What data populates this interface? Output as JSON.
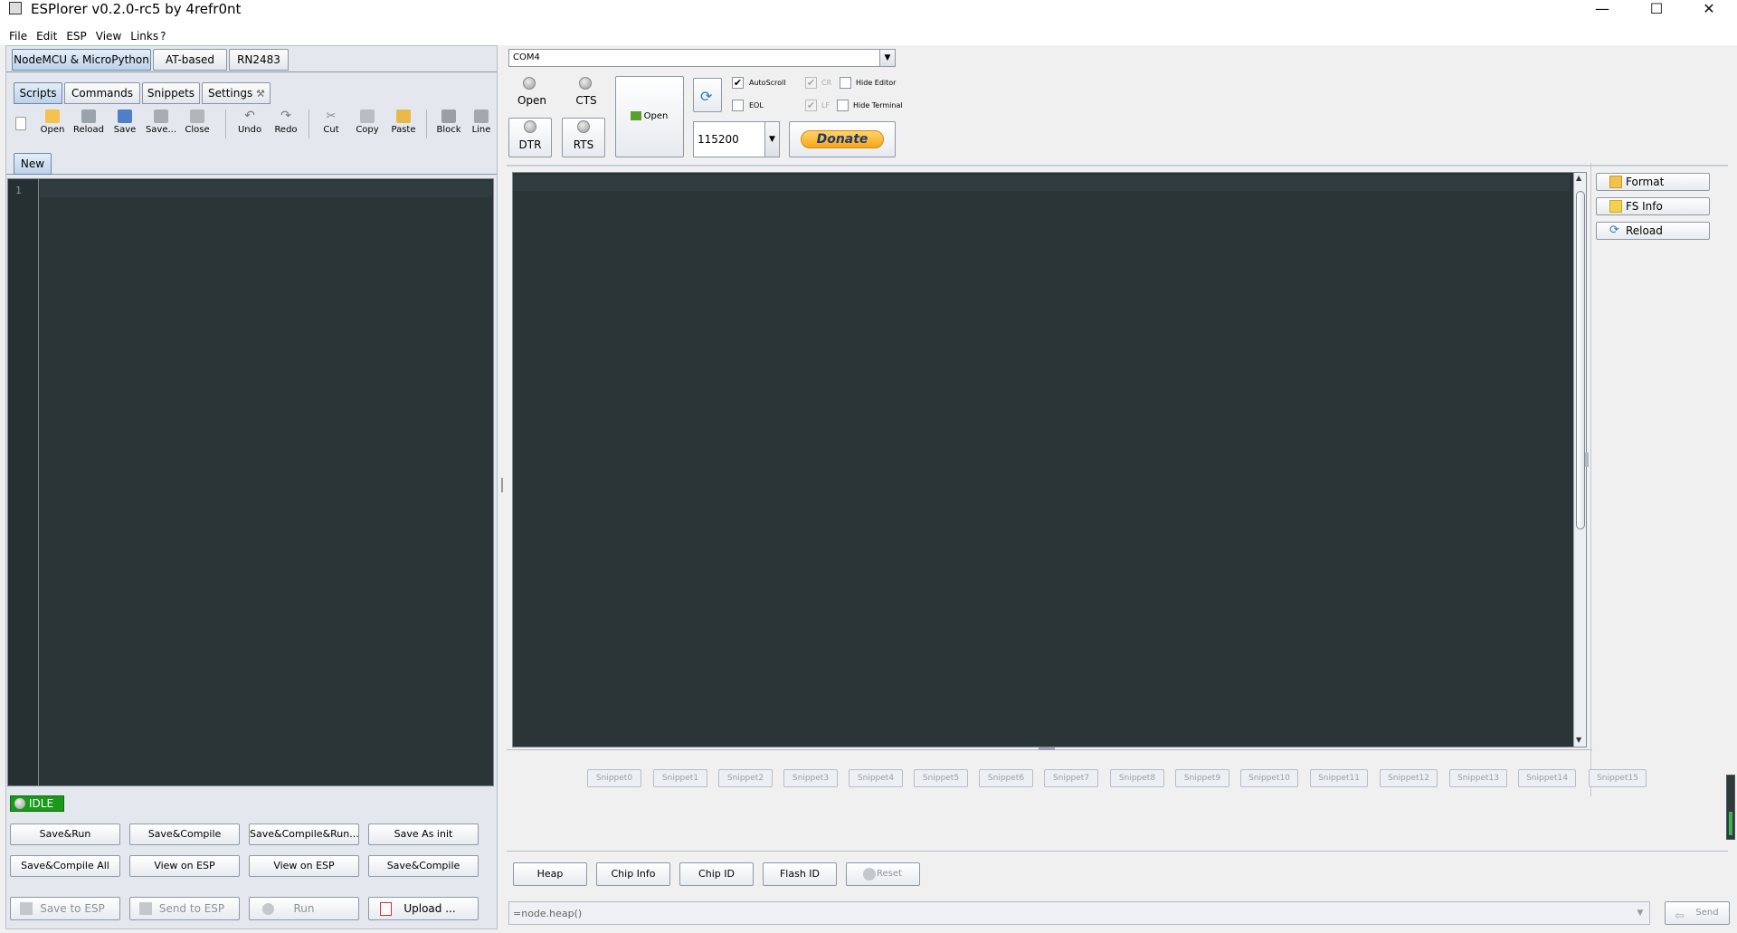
{
  "window": {
    "title": "ESPlorer v0.2.0-rc5 by 4refr0nt",
    "minimize_glyph": "—",
    "maximize_glyph": "☐",
    "close_glyph": "✕"
  },
  "menu": [
    "File",
    "Edit",
    "ESP",
    "View",
    "Links",
    "?"
  ],
  "device_tabs": [
    "NodeMCU & MicroPython",
    "AT-based",
    "RN2483"
  ],
  "sub_tabs": [
    "Scripts",
    "Commands",
    "Snippets",
    "Settings"
  ],
  "toolbar": [
    "Open",
    "Reload",
    "Save",
    "Save...",
    "Close",
    "Undo",
    "Redo",
    "Cut",
    "Copy",
    "Paste",
    "Block",
    "Line"
  ],
  "editor": {
    "tab": "New",
    "line_number": "1"
  },
  "status": {
    "label": "IDLE",
    "color": "#1a9a1a"
  },
  "left_buttons": {
    "row1": [
      "Save&Run",
      "Save&Compile",
      "Save&Compile&Run...",
      "Save As init"
    ],
    "row2": [
      "Save&Compile All",
      "View on ESP",
      "View on ESP",
      "Save&Compile"
    ],
    "row3": [
      "Save to ESP",
      "Send to ESP",
      "Run",
      "Upload ..."
    ]
  },
  "port": {
    "value": "COM4",
    "baud": "115200"
  },
  "signals": {
    "open": "Open",
    "cts": "CTS",
    "dtr": "DTR",
    "rts": "RTS"
  },
  "open_button": "Open",
  "donate": "Donate",
  "options": {
    "autoscroll": "AutoScroll",
    "eol": "EOL",
    "cr": "CR",
    "lf": "LF",
    "hide_editor": "Hide Editor",
    "hide_terminal": "Hide Terminal"
  },
  "side_buttons": [
    "Format",
    "FS Info",
    "Reload"
  ],
  "snippets": [
    "Snippet0",
    "Snippet1",
    "Snippet2",
    "Snippet3",
    "Snippet4",
    "Snippet5",
    "Snippet6",
    "Snippet7",
    "Snippet8",
    "Snippet9",
    "Snippet10",
    "Snippet11",
    "Snippet12",
    "Snippet13",
    "Snippet14",
    "Snippet15"
  ],
  "bottom_buttons": [
    "Heap",
    "Chip Info",
    "Chip ID",
    "Flash ID",
    "Reset"
  ],
  "command": {
    "value": "=node.heap()",
    "send": "Send"
  },
  "colors": {
    "editor_bg": "#2b3437",
    "tab_active": "#bcd2ea",
    "donate": "#f7b731"
  }
}
